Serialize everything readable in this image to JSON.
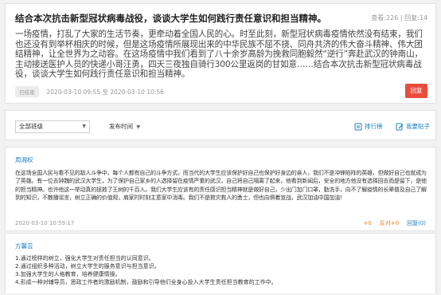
{
  "topic": {
    "title": "结合本次抗击新型冠状病毒战役，谈谈大学生如何践行责任意识和担当精神。",
    "views": "查看:226",
    "replies": "回复:14",
    "body": "一场疫情，打乱了大家的生活节奏，更牵动着全国人民的心。时至此刻，新型冠状病毒疫情依然没有结束，我们也还没有到举杯相庆的时候，但是这场疫情所展现出来的中华民族不屈不挠、同舟共济的伟大奋斗精神、伟大团结精神，让全世界为之动容。在这场疫情中我们看到了八十余岁高龄为挽救同胞毅然“逆行”奔赴武汉的钟南山，主动接送医护人员的快递小哥汪勇，四天三夜独自骑行300公里返岗的甘如意……结合本次抗击新型冠状病毒战役，谈谈大学生如何践行责任意识和担当精神。",
    "status_badge": "已结束",
    "date_range": "2020-03-10 09:55 至 2020-03-10 10:56",
    "reply_label": "回复"
  },
  "filter": {
    "class_select": "全部班级",
    "sort_label": "发布时间",
    "rank_label": "排行榜",
    "post_label": "我要贴子"
  },
  "posts": [
    {
      "author": "周湘权",
      "body": "在这场全国人民与看不见的敌人斗争中，每个人都有自己的斗争方式，而当代的大学生应该保护好自己也保护好身边的亲人，我们不是冲锋陷阵的英雄，但做好自己也就成为了英雄。有一位去钟魏的武汉大学生，为了保护自己家乡的人选择留在疫情严重的武汉，自己将自己隔离了起来，他看到新闻后，安全的地方他没有选择回去而是留下，是他的担当精神。也许他这一举动真的拯救了王树的千百人。我们大学生应该有的责任感识担当精神就是做好自己，少出门加门口罩，勤洗手，向不了解疫情的长辈普及自己了解到的知识，不散播谣言，树立正确的价值观，肩家时时刻主意家中消毒。我们不是救灾救人的勇士，但也向俱着宣战，武汉加油中国加油！",
      "date": "2020-03-10 10:59:17",
      "up": "+0",
      "down": "反对+0",
      "reply": "回复(0)"
    },
    {
      "author": "方馨芸",
      "lines": [
        "1.通过榜样的树立，强化大学生对责任担当的认同意识。",
        "2.通过组织多种活动，树立大学生的服务意识与担当意识。",
        "3.加强大学生的人格教育，培养健康情操。",
        "4.形成一种对辅导员，思政工作者的激励机制，鼓励和引导他们全身心投入大学生责任担当教育的工作中。"
      ]
    }
  ],
  "colors": {
    "accent": "#1e7fc6",
    "danger": "#e84c3d",
    "vote": "#e67e22"
  },
  "icons": {
    "rank": "trophy-icon",
    "post": "compose-icon"
  }
}
